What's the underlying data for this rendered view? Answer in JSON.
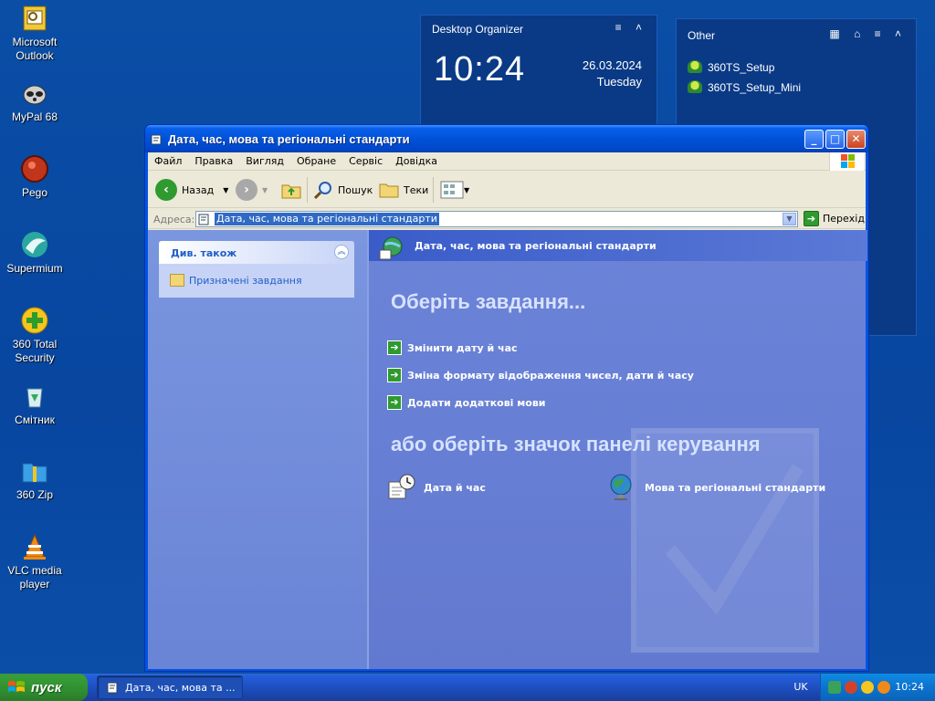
{
  "desktop": {
    "icons": [
      {
        "label": "Microsoft Outlook"
      },
      {
        "label": "MyPal 68"
      },
      {
        "label": "Pego"
      },
      {
        "label": "Supermium"
      },
      {
        "label": "360 Total Security"
      },
      {
        "label": "Смітник"
      },
      {
        "label": "360 Zip"
      },
      {
        "label": "VLC media player"
      }
    ]
  },
  "widgets": {
    "organizer": {
      "title": "Desktop Organizer",
      "time": "10:24",
      "date": "26.03.2024",
      "weekday": "Tuesday"
    },
    "other": {
      "title": "Other",
      "items": [
        "360TS_Setup",
        "360TS_Setup_Mini"
      ]
    }
  },
  "window": {
    "title": "Дата, час, мова та регіональні стандарти",
    "menu": [
      "Файл",
      "Правка",
      "Вигляд",
      "Обране",
      "Сервіс",
      "Довідка"
    ],
    "toolbar": {
      "back": "Назад",
      "search": "Пошук",
      "folders": "Теки"
    },
    "address": {
      "label": "Адреса:",
      "value": "Дата, час, мова та регіональні стандарти",
      "go": "Перехід"
    },
    "left": {
      "see_also_title": "Див. також",
      "scheduled_tasks": "Призначені завдання"
    },
    "right": {
      "header": "Дата, час, мова та регіональні стандарти",
      "pick_task": "Оберіть завдання...",
      "tasks": [
        "Змінити дату й час",
        "Зміна формату відображення чисел, дати й часу",
        "Додати додаткові мови"
      ],
      "or_pick": "або оберіть значок панелі керування",
      "icons": [
        "Дата й час",
        "Мова та регіональні стандарти"
      ]
    }
  },
  "taskbar": {
    "start": "пуск",
    "task_button": "Дата, час, мова та ...",
    "lang": "UK",
    "clock": "10:24"
  },
  "colors": {
    "desktop_blue": "#0a4ea6",
    "title_blue": "#0052d8",
    "start_green": "#2f8a2f",
    "task_pane": "#6b84d8",
    "link_blue": "#215dc6"
  }
}
